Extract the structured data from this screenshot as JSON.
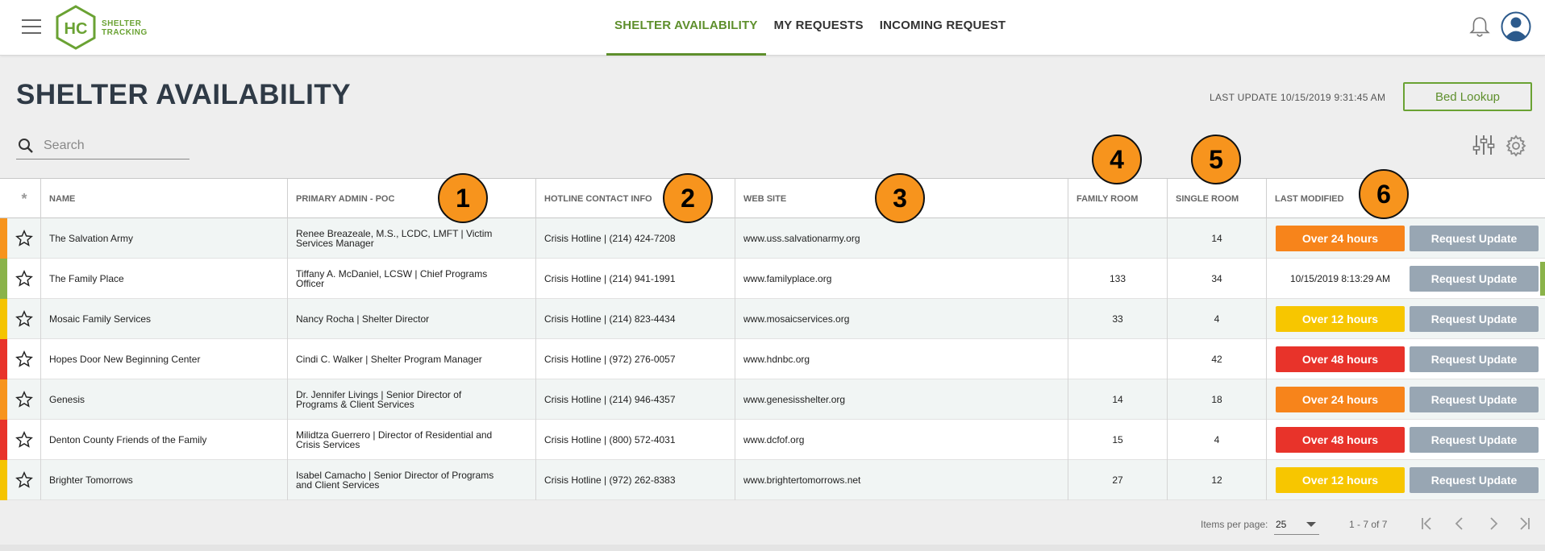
{
  "app": {
    "logo_letters": "HC",
    "logo_line1": "SHELTER",
    "logo_line2": "TRACKING",
    "brand_color": "#6aa233"
  },
  "nav": {
    "items": [
      {
        "label": "SHELTER AVAILABILITY",
        "active": true
      },
      {
        "label": "MY REQUESTS",
        "active": false
      },
      {
        "label": "INCOMING REQUEST",
        "active": false
      }
    ]
  },
  "page": {
    "title": "SHELTER AVAILABILITY",
    "last_update": "LAST UPDATE 10/15/2019 9:31:45 AM",
    "bed_lookup_label": "Bed Lookup"
  },
  "search": {
    "placeholder": "Search",
    "value": ""
  },
  "table": {
    "columns": {
      "star": "*",
      "name": "NAME",
      "poc": "PRIMARY ADMIN - POC",
      "hotline": "HOTLINE CONTACT INFO",
      "website": "WEB SITE",
      "family": "FAMILY ROOM",
      "single": "SINGLE ROOM",
      "modified": "LAST MODIFIED"
    },
    "rows": [
      {
        "status_color": "#f7941d",
        "name": "The Salvation Army",
        "poc": "Renee Breazeale, M.S., LCDC, LMFT | Victim Services Manager",
        "hotline": "Crisis Hotline | (214) 424-7208",
        "website": "www.uss.salvationarmy.org",
        "family": "",
        "single": "14",
        "modified": "Over 24 hours",
        "modified_color": "#f7841b",
        "request": "Request Update"
      },
      {
        "status_color": "#8ab34a",
        "name": "The Family Place",
        "poc": "Tiffany A. McDaniel, LCSW | Chief Programs Officer",
        "hotline": "Crisis Hotline | (214) 941-1991",
        "website": "www.familyplace.org",
        "family": "133",
        "single": "34",
        "modified": "10/15/2019 8:13:29 AM",
        "modified_color": "",
        "request": "Request Update"
      },
      {
        "status_color": "#f5c400",
        "name": "Mosaic Family Services",
        "poc": "Nancy Rocha | Shelter Director",
        "hotline": "Crisis Hotline | (214) 823-4434",
        "website": "www.mosaicservices.org",
        "family": "33",
        "single": "4",
        "modified": "Over 12 hours",
        "modified_color": "#f7c600",
        "request": "Request Update"
      },
      {
        "status_color": "#e8332a",
        "name": "Hopes Door New Beginning Center",
        "poc": "Cindi C. Walker | Shelter Program Manager",
        "hotline": "Crisis Hotline | (972) 276-0057",
        "website": "www.hdnbc.org",
        "family": "",
        "single": "42",
        "modified": "Over 48 hours",
        "modified_color": "#e8332a",
        "request": "Request Update"
      },
      {
        "status_color": "#f7941d",
        "name": "Genesis",
        "poc": "Dr. Jennifer Livings | Senior Director of Programs & Client Services",
        "hotline": "Crisis Hotline | (214) 946-4357",
        "website": "www.genesisshelter.org",
        "family": "14",
        "single": "18",
        "modified": "Over 24 hours",
        "modified_color": "#f7841b",
        "request": "Request Update"
      },
      {
        "status_color": "#e8332a",
        "name": "Denton County Friends of the Family",
        "poc": "Milidtza Guerrero | Director of Residential and Crisis Services",
        "hotline": "Crisis Hotline | (800) 572-4031",
        "website": "www.dcfof.org",
        "family": "15",
        "single": "4",
        "modified": "Over 48 hours",
        "modified_color": "#e8332a",
        "request": "Request Update"
      },
      {
        "status_color": "#f5c400",
        "name": "Brighter Tomorrows",
        "poc": "Isabel Camacho | Senior Director of Programs and Client Services",
        "hotline": "Crisis Hotline | (972) 262-8383",
        "website": "www.brightertomorrows.net",
        "family": "27",
        "single": "12",
        "modified": "Over 12 hours",
        "modified_color": "#f7c600",
        "request": "Request Update"
      }
    ]
  },
  "callouts": [
    "1",
    "2",
    "3",
    "4",
    "5",
    "6"
  ],
  "pagination": {
    "items_per_page_label": "Items per page:",
    "items_per_page": "25",
    "range": "1 - 7 of 7"
  }
}
